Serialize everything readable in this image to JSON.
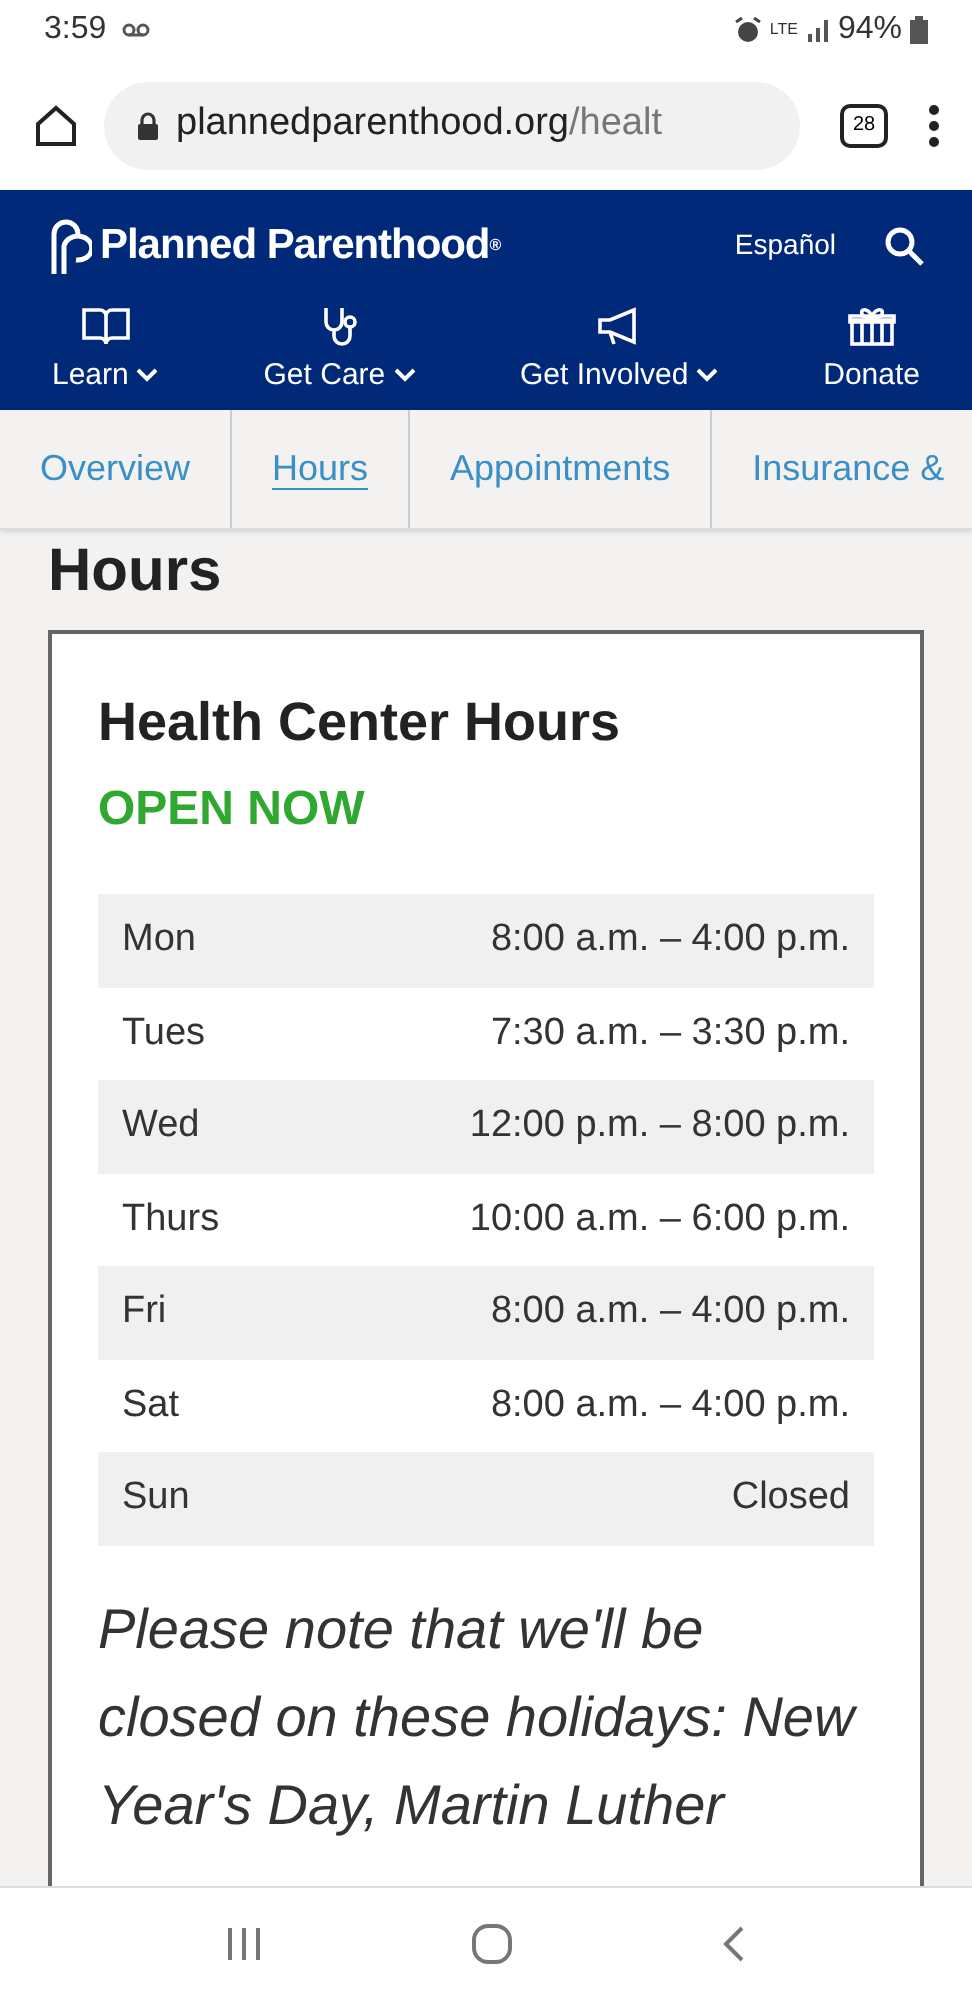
{
  "status_bar": {
    "time": "3:59",
    "network": "LTE",
    "battery": "94%"
  },
  "browser": {
    "url_host": "plannedparenthood.org",
    "url_path": "/healt",
    "tab_count": "28"
  },
  "header": {
    "logo": "Planned Parenthood",
    "logo_mark": "®",
    "language": "Español"
  },
  "nav": [
    {
      "label": "Learn",
      "kind": "dropdown"
    },
    {
      "label": "Get Care",
      "kind": "dropdown"
    },
    {
      "label": "Get Involved",
      "kind": "dropdown"
    },
    {
      "label": "Donate",
      "kind": "link"
    }
  ],
  "tabs": [
    {
      "label": "Overview",
      "selected": false
    },
    {
      "label": "Hours",
      "selected": true
    },
    {
      "label": "Appointments",
      "selected": false
    },
    {
      "label": "Insurance &",
      "selected": false
    }
  ],
  "page_heading": "Hours",
  "card": {
    "title": "Health Center Hours",
    "status": "OPEN NOW",
    "hours": [
      {
        "day": "Mon",
        "time": "8:00 a.m. – 4:00 p.m."
      },
      {
        "day": "Tues",
        "time": "7:30 a.m. – 3:30 p.m."
      },
      {
        "day": "Wed",
        "time": "12:00 p.m. – 8:00 p.m."
      },
      {
        "day": "Thurs",
        "time": "10:00 a.m. – 6:00 p.m."
      },
      {
        "day": "Fri",
        "time": "8:00 a.m. – 4:00 p.m."
      },
      {
        "day": "Sat",
        "time": "8:00 a.m. – 4:00 p.m."
      },
      {
        "day": "Sun",
        "time": "Closed"
      }
    ],
    "note": "Please note that we'll be closed on these holidays: New Year's Day, Martin Luther"
  }
}
